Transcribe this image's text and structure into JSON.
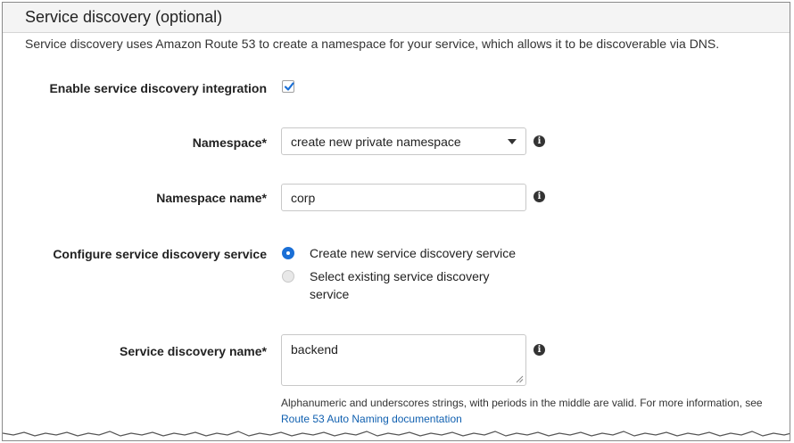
{
  "section": {
    "title": "Service discovery (optional)",
    "description": "Service discovery uses Amazon Route 53 to create a namespace for your service, which allows it to be discoverable via DNS."
  },
  "enable": {
    "label": "Enable service discovery integration",
    "checked": true
  },
  "namespace": {
    "label": "Namespace*",
    "value": "create new private namespace"
  },
  "namespace_name": {
    "label": "Namespace name*",
    "value": "corp"
  },
  "configure": {
    "label": "Configure service discovery service",
    "options": [
      {
        "label": "Create new service discovery service",
        "selected": true
      },
      {
        "label_line1": "Select existing service discovery",
        "label_line2": "service",
        "selected": false
      }
    ]
  },
  "discovery_name": {
    "label": "Service discovery name*",
    "value": "backend",
    "help": "Alphanumeric and underscores strings, with periods in the middle are valid. For more information, see",
    "help_link": "Route 53 Auto Naming documentation"
  },
  "icons": {
    "info": "info-icon",
    "check": "checkmark-icon",
    "caret": "chevron-down-icon"
  },
  "colors": {
    "accent": "#1a6fd6",
    "link": "#1060b0",
    "header_bg": "#f4f4f4"
  }
}
